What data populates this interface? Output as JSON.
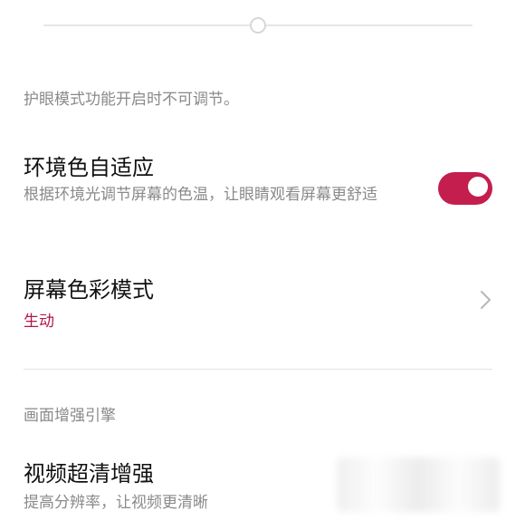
{
  "brightness": {
    "level": 0.5
  },
  "eye_care_note": "护眼模式功能开启时不可调节。",
  "adaptive_color": {
    "title": "环境色自适应",
    "subtitle": "根据环境光调节屏幕的色温，让眼睛观看屏幕更舒适",
    "enabled": true,
    "accent_color": "#c41e4e"
  },
  "screen_color_mode": {
    "title": "屏幕色彩模式",
    "value": "生动",
    "value_color": "#b0184a",
    "icon": "chevron-right-icon"
  },
  "picture_engine": {
    "header": "画面增强引擎",
    "super_clear": {
      "title": "视频超清增强",
      "subtitle": "提高分辨率，让视频更清晰"
    }
  }
}
